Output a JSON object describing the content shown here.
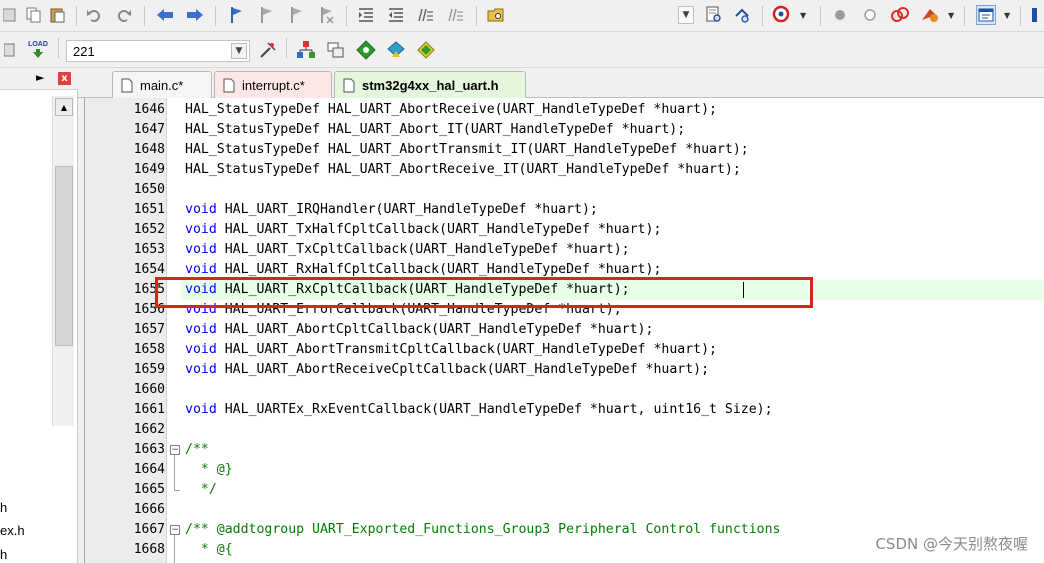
{
  "toolbar_top": {
    "icons": [
      "cut-icon",
      "copy-icon",
      "paste-icon",
      "undo-icon",
      "redo-icon",
      "navigate-back-icon",
      "navigate-forward-icon",
      "bookmark-icon",
      "prev-bookmark-icon",
      "next-bookmark-icon",
      "clear-bookmarks-icon",
      "indent-icon",
      "unindent-icon",
      "comment-icon",
      "uncomment-icon",
      "find-in-files-icon",
      "find-icon",
      "incremental-find-icon",
      "debug-icon",
      "breakpoint-icon",
      "disable-breakpoint-icon",
      "kill-breakpoints-icon",
      "configure-icon",
      "window-layout-icon",
      "settings-icon"
    ]
  },
  "toolbar_build": {
    "load_label": "LOAD",
    "target_value": "221"
  },
  "left_panel": {
    "files": [
      "h",
      "ex.h",
      "h"
    ]
  },
  "tabs": [
    {
      "label": "main.c*",
      "color": "#f5f5f5",
      "active": false
    },
    {
      "label": "interrupt.c*",
      "color": "#fde7e6",
      "active": false
    },
    {
      "label": "stm32g4xx_hal_uart.h",
      "color": "#e4f6dc",
      "active": true
    }
  ],
  "editor": {
    "lines": [
      {
        "num": "1646",
        "kw": "",
        "text": "HAL_StatusTypeDef HAL_UART_AbortReceive(UART_HandleTypeDef *huart);"
      },
      {
        "num": "1647",
        "kw": "",
        "text": "HAL_StatusTypeDef HAL_UART_Abort_IT(UART_HandleTypeDef *huart);"
      },
      {
        "num": "1648",
        "kw": "",
        "text": "HAL_StatusTypeDef HAL_UART_AbortTransmit_IT(UART_HandleTypeDef *huart);"
      },
      {
        "num": "1649",
        "kw": "",
        "text": "HAL_StatusTypeDef HAL_UART_AbortReceive_IT(UART_HandleTypeDef *huart);"
      },
      {
        "num": "1650",
        "kw": "",
        "text": ""
      },
      {
        "num": "1651",
        "kw": "void",
        "text": " HAL_UART_IRQHandler(UART_HandleTypeDef *huart);"
      },
      {
        "num": "1652",
        "kw": "void",
        "text": " HAL_UART_TxHalfCpltCallback(UART_HandleTypeDef *huart);"
      },
      {
        "num": "1653",
        "kw": "void",
        "text": " HAL_UART_TxCpltCallback(UART_HandleTypeDef *huart);"
      },
      {
        "num": "1654",
        "kw": "void",
        "text": " HAL_UART_RxHalfCpltCallback(UART_HandleTypeDef *huart);"
      },
      {
        "num": "1655",
        "kw": "void",
        "text": " HAL_UART_RxCpltCallback(UART_HandleTypeDef *huart);"
      },
      {
        "num": "1656",
        "kw": "void",
        "text": " HAL_UART_ErrorCallback(UART_HandleTypeDef *huart);"
      },
      {
        "num": "1657",
        "kw": "void",
        "text": " HAL_UART_AbortCpltCallback(UART_HandleTypeDef *huart);"
      },
      {
        "num": "1658",
        "kw": "void",
        "text": " HAL_UART_AbortTransmitCpltCallback(UART_HandleTypeDef *huart);"
      },
      {
        "num": "1659",
        "kw": "void",
        "text": " HAL_UART_AbortReceiveCpltCallback(UART_HandleTypeDef *huart);"
      },
      {
        "num": "1660",
        "kw": "",
        "text": ""
      },
      {
        "num": "1661",
        "kw": "void",
        "text": " HAL_UARTEx_RxEventCallback(UART_HandleTypeDef *huart, uint16_t Size);"
      },
      {
        "num": "1662",
        "kw": "",
        "text": ""
      },
      {
        "num": "1663",
        "kw": "",
        "cm": "/**"
      },
      {
        "num": "1664",
        "kw": "",
        "cm": "  * @}"
      },
      {
        "num": "1665",
        "kw": "",
        "cm": "  */"
      },
      {
        "num": "1666",
        "kw": "",
        "text": ""
      },
      {
        "num": "1667",
        "kw": "",
        "cm": "/** @addtogroup UART_Exported_Functions_Group3 Peripheral Control functions"
      },
      {
        "num": "1668",
        "kw": "",
        "cm": "  * @{"
      }
    ]
  },
  "watermark": "CSDN @今天别熬夜喔"
}
